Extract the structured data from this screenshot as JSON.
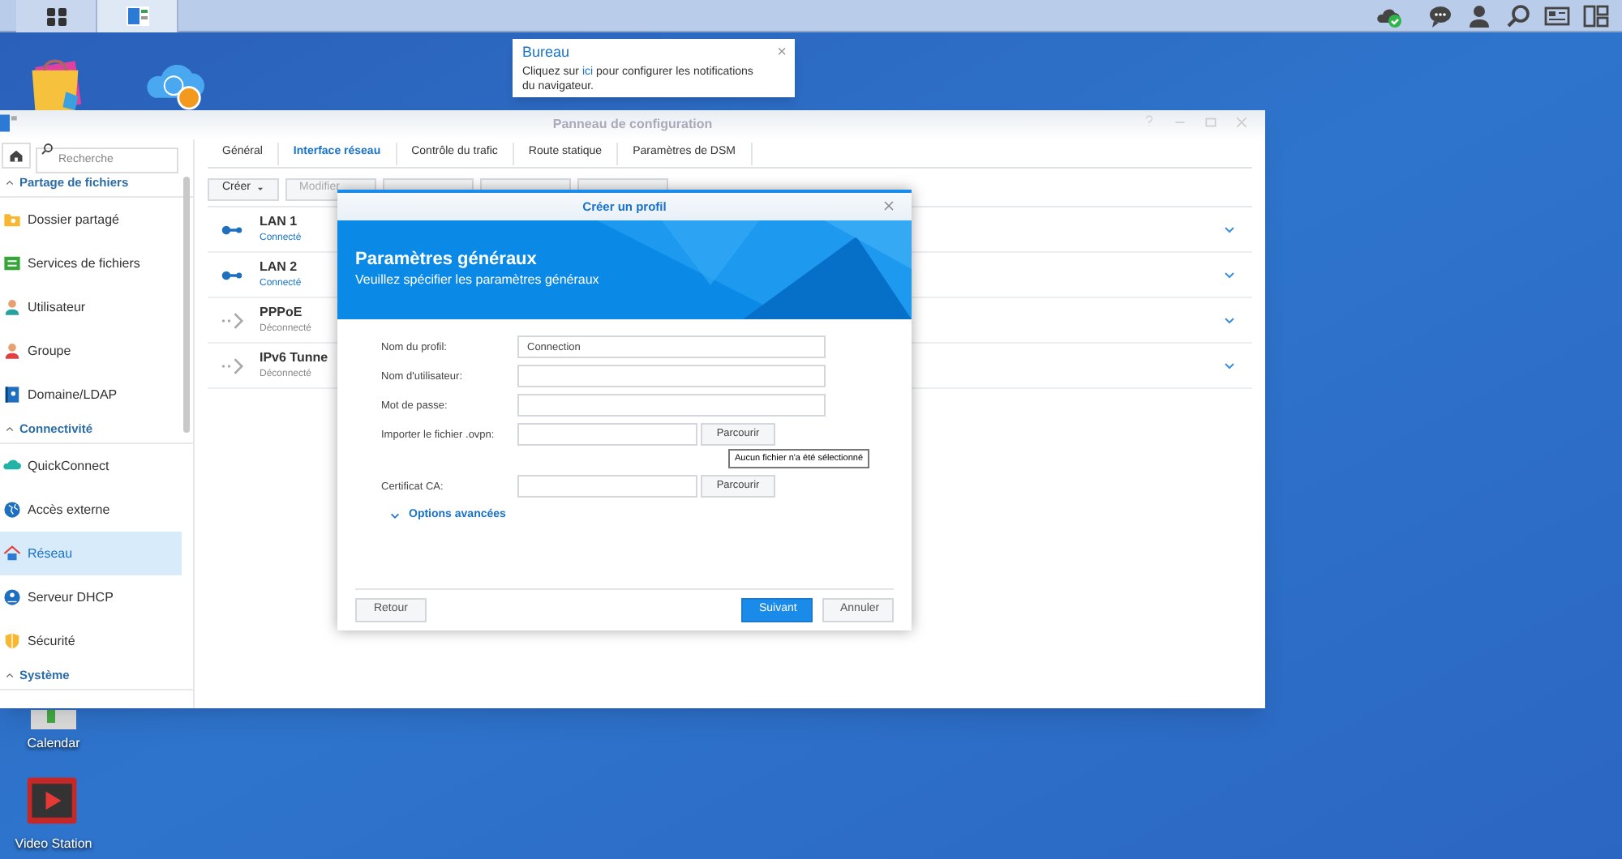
{
  "taskbar": {
    "apps": [
      {
        "kind": "grid",
        "selected": false
      },
      {
        "kind": "panel",
        "selected": true
      }
    ]
  },
  "desktop_icons": [
    {
      "kind": "bag"
    },
    {
      "kind": "cloud"
    },
    {
      "kind": "calendar",
      "label": "Calendar"
    },
    {
      "kind": "video",
      "label": "Video Station"
    }
  ],
  "notification": {
    "title": "Bureau",
    "message_before": "Cliquez sur",
    "link": "ici",
    "message_after": "pour configurer les notifications du navigateur.",
    "close": "×"
  },
  "window": {
    "title": "Panneau de configuration",
    "search": {
      "placeholder": "Recherche"
    },
    "sidebar": [
      {
        "kind": "section",
        "label": "Partage de fichiers",
        "expanded": true
      },
      {
        "kind": "item",
        "label": "Dossier partagé",
        "selected": false
      },
      {
        "kind": "item",
        "label": "Services de fichiers",
        "selected": false
      },
      {
        "kind": "item",
        "label": "Utilisateur",
        "selected": false
      },
      {
        "kind": "item",
        "label": "Groupe",
        "selected": false
      },
      {
        "kind": "item",
        "label": "Domaine/LDAP",
        "selected": false
      },
      {
        "kind": "section",
        "label": "Connectivité",
        "expanded": true
      },
      {
        "kind": "item",
        "label": "QuickConnect",
        "selected": false
      },
      {
        "kind": "item",
        "label": "Accès externe",
        "selected": false
      },
      {
        "kind": "item",
        "label": "Réseau",
        "selected": true
      },
      {
        "kind": "item",
        "label": "Serveur DHCP",
        "selected": false
      },
      {
        "kind": "item",
        "label": "Sécurité",
        "selected": false
      },
      {
        "kind": "section",
        "label": "Système",
        "expanded": true
      }
    ],
    "tabs": [
      {
        "label": "Général",
        "selected": false
      },
      {
        "label": "Interface réseau",
        "selected": true
      },
      {
        "label": "Contrôle du trafic",
        "selected": false
      },
      {
        "label": "Route statique",
        "selected": false
      },
      {
        "label": "Paramètres de DSM",
        "selected": false
      }
    ],
    "toolbar": [
      {
        "label": "Créer",
        "dropdown": true,
        "disabled": false
      },
      {
        "label": "Modifier",
        "dropdown": false,
        "disabled": true
      },
      {
        "dropdown": false,
        "disabled": true
      },
      {
        "dropdown": false,
        "disabled": true
      },
      {
        "dropdown": false,
        "disabled": true
      }
    ],
    "interfaces": [
      {
        "name": "LAN 1",
        "status": "Connecté",
        "connected": true
      },
      {
        "name": "LAN 2",
        "status": "Connecté",
        "connected": true
      },
      {
        "name": "PPPoE",
        "status": "Déconnecté",
        "connected": false
      },
      {
        "name": "IPv6 Tunne",
        "status": "Déconnecté",
        "connected": false
      }
    ]
  },
  "dialog": {
    "title": "Créer un profil",
    "heading": "Paramètres généraux",
    "subheading": "Veuillez spécifier les paramètres généraux",
    "fields": [
      {
        "label": "Nom du profil:",
        "value": "Connection",
        "kind": "text"
      },
      {
        "label": "Nom d'utilisateur:",
        "kind": "text"
      },
      {
        "label": "Mot de passe:",
        "kind": "text"
      },
      {
        "label": "Importer le fichier .ovpn:",
        "kind": "file",
        "button": "Parcourir"
      },
      {
        "label": "Certificat CA:",
        "kind": "file",
        "button": "Parcourir"
      }
    ],
    "tooltip": "Aucun fichier n'a été sélectionné",
    "advanced": {
      "label": "Options avancées",
      "expanded": false
    },
    "buttons": [
      {
        "label": "Retour",
        "primary": false
      },
      {
        "label": "Suivant",
        "primary": true
      },
      {
        "label": "Annuler",
        "primary": false
      }
    ]
  }
}
